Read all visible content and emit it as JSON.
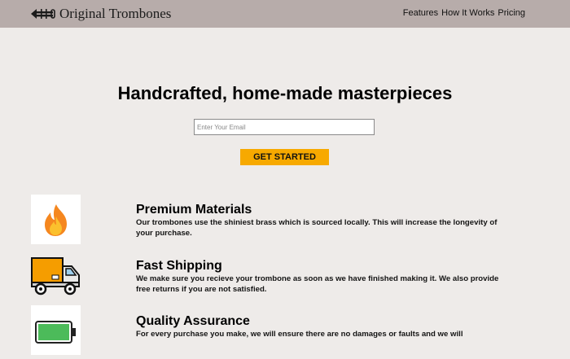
{
  "header": {
    "brand": "Original Trombones",
    "nav": [
      "Features",
      "How It Works",
      "Pricing"
    ]
  },
  "hero": {
    "title": "Handcrafted, home-made masterpieces",
    "email_placeholder": "Enter Your Email",
    "cta_label": "GET STARTED"
  },
  "features": [
    {
      "icon": "fire-icon",
      "title": "Premium Materials",
      "desc": "Our trombones use the shiniest brass which is sourced locally. This will increase the longevity of your purchase."
    },
    {
      "icon": "truck-icon",
      "title": "Fast Shipping",
      "desc": "We make sure you recieve your trombone as soon as we have finished making it. We also provide free returns if you are not satisfied."
    },
    {
      "icon": "battery-icon",
      "title": "Quality Assurance",
      "desc": "For every purchase you make, we will ensure there are no damages or faults and we will"
    }
  ],
  "colors": {
    "header_bg": "#b7acaa",
    "page_bg": "#eeebe9",
    "cta_bg": "#f7a900"
  }
}
